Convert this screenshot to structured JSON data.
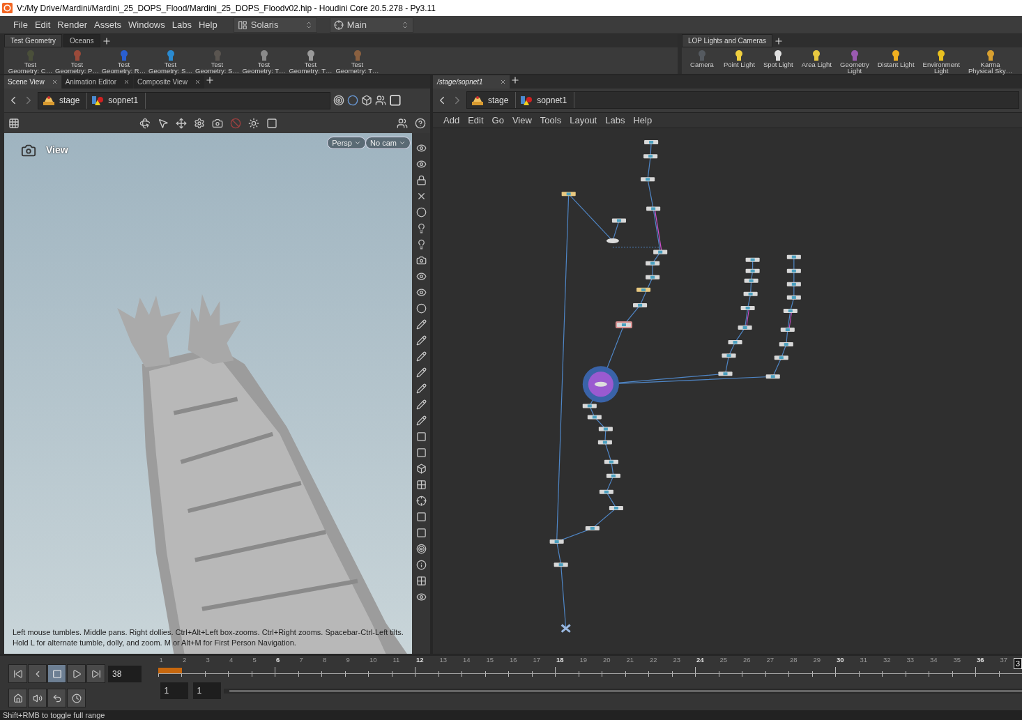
{
  "title_bar": {
    "title": "V:/My Drive/Mardini/Mardini_25_DOPS_Flood/Mardini_25_DOPS_Floodv02.hip - Houdini Core 20.5.278 - Py3.11"
  },
  "menu": [
    "File",
    "Edit",
    "Render",
    "Assets",
    "Windows",
    "Labs",
    "Help"
  ],
  "desktop": {
    "label": "Solaris"
  },
  "viewer_set": {
    "label": "Main"
  },
  "shelf_left": {
    "tabs": [
      {
        "label": "Test Geometry",
        "selected": true
      },
      {
        "label": "Oceans",
        "selected": false
      }
    ],
    "tools": [
      {
        "lines": [
          "Test",
          "Geometry: C…"
        ],
        "color": "#4a4f3a"
      },
      {
        "lines": [
          "Test",
          "Geometry: P…"
        ],
        "color": "#9a4a3a"
      },
      {
        "lines": [
          "Test",
          "Geometry: R…"
        ],
        "color": "#2a5fd0"
      },
      {
        "lines": [
          "Test",
          "Geometry: S…"
        ],
        "color": "#2a8ad0"
      },
      {
        "lines": [
          "Test",
          "Geometry: S…"
        ],
        "color": "#5a5550"
      },
      {
        "lines": [
          "Test",
          "Geometry: T…"
        ],
        "color": "#8a8a8a"
      },
      {
        "lines": [
          "Test",
          "Geometry: T…"
        ],
        "color": "#9a9a9a"
      },
      {
        "lines": [
          "Test",
          "Geometry: T…"
        ],
        "color": "#8a6040"
      }
    ]
  },
  "shelf_right": {
    "tabs": [
      {
        "label": "LOP Lights and Cameras",
        "selected": true
      }
    ],
    "tools": [
      {
        "lines": [
          "Camera"
        ],
        "color": "#555a60"
      },
      {
        "lines": [
          "Point Light"
        ],
        "color": "#f0d040"
      },
      {
        "lines": [
          "Spot Light"
        ],
        "color": "#e0e0e0"
      },
      {
        "lines": [
          "Area Light"
        ],
        "color": "#e8c840"
      },
      {
        "lines": [
          "Geometry",
          "Light"
        ],
        "color": "#9a5ab0"
      },
      {
        "lines": [
          "Distant Light"
        ],
        "color": "#f0b020"
      },
      {
        "lines": [
          "Environment",
          "Light"
        ],
        "color": "#e8c020"
      },
      {
        "lines": [
          "Karma",
          "Physical Sky…"
        ],
        "color": "#d8a030"
      }
    ]
  },
  "left_pane": {
    "tabs": [
      {
        "label": "Scene View",
        "selected": true
      },
      {
        "label": "Animation Editor",
        "selected": false
      },
      {
        "label": "Composite View",
        "selected": false
      }
    ],
    "path": [
      "stage",
      "sopnet1"
    ],
    "viewport": {
      "title": "View",
      "projection": "Persp",
      "camera": "No cam",
      "hint_lines": [
        "Left mouse tumbles. Middle pans. Right dollies. Ctrl+Alt+Left box-zooms. Ctrl+Right zooms. Spacebar-Ctrl-Left tilts.",
        "Hold L for alternate tumble, dolly, and zoom. M or Alt+M for First Person Navigation."
      ]
    }
  },
  "right_pane": {
    "tabs": [
      {
        "label": "/stage/sopnet1",
        "selected": true
      }
    ],
    "path": [
      "stage",
      "sopnet1"
    ],
    "menu": [
      "Add",
      "Edit",
      "Go",
      "View",
      "Tools",
      "Layout",
      "Labs",
      "Help"
    ]
  },
  "timeline": {
    "frame": "38",
    "range_start": "1",
    "range_end": "1",
    "ticks": [
      "1",
      "2",
      "3",
      "4",
      "5",
      "6",
      "7",
      "8",
      "9",
      "10",
      "11",
      "12",
      "13",
      "14",
      "15",
      "16",
      "17",
      "18",
      "19",
      "20",
      "21",
      "22",
      "23",
      "24",
      "25",
      "26",
      "27",
      "28",
      "29",
      "30",
      "31",
      "32",
      "33",
      "34",
      "35",
      "36",
      "37"
    ],
    "playhead_label": "3",
    "range_slider": {
      "level": 1
    }
  },
  "status_bar": {
    "text": "Shift+RMB to toggle full range"
  }
}
